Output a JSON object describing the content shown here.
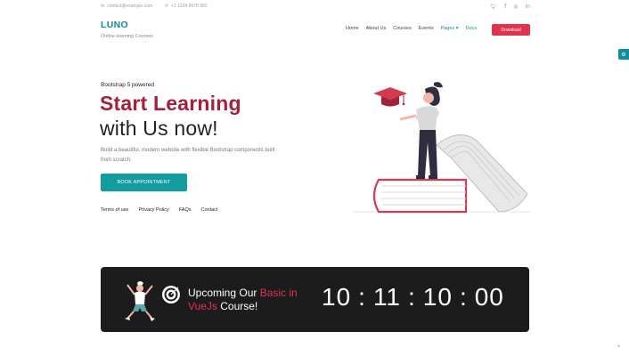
{
  "topbar": {
    "email": "contact@example.com",
    "phone": "+1 1234 5678 990",
    "email_icon": "envelope-icon",
    "phone_icon": "phone-icon",
    "social": [
      {
        "icon": "twitter-icon",
        "glyph": "𝕥"
      },
      {
        "icon": "facebook-icon",
        "glyph": "f"
      },
      {
        "icon": "instagram-icon",
        "glyph": "◎"
      },
      {
        "icon": "linkedin-icon",
        "glyph": "in"
      }
    ]
  },
  "header": {
    "brand": "LUNO",
    "tagline": "Online learning Courses",
    "nav": [
      {
        "label": "Home"
      },
      {
        "label": "About Us"
      },
      {
        "label": "Courses"
      },
      {
        "label": "Events"
      },
      {
        "label": "Pages ▾"
      },
      {
        "label": "Docs"
      }
    ],
    "download_label": "Download"
  },
  "hero": {
    "eyebrow": "Bootstrap 5 powered",
    "title_line1": "Start Learning",
    "title_line2": "with Us now!",
    "description": "Build a beautiful, modern website with flexible Bootstrap components built from scratch.",
    "cta_label": "BOOK APPOINTMENT",
    "links": [
      "Terms of use",
      "Privacy Policy",
      "FAQs",
      "Contact"
    ]
  },
  "banner": {
    "text_before": "Upcoming Our ",
    "text_highlight_1": "Basic in",
    "text_highlight_2": "VueJs",
    "text_after": " Course!",
    "timer": {
      "days": "10",
      "hours": "11",
      "minutes": "10",
      "seconds": "00",
      "separator": ":"
    }
  },
  "colors": {
    "accent_teal": "#0f8f9a",
    "accent_red": "#e2324d",
    "title_red": "#a3213a",
    "banner_bg": "#1c1c1c"
  }
}
